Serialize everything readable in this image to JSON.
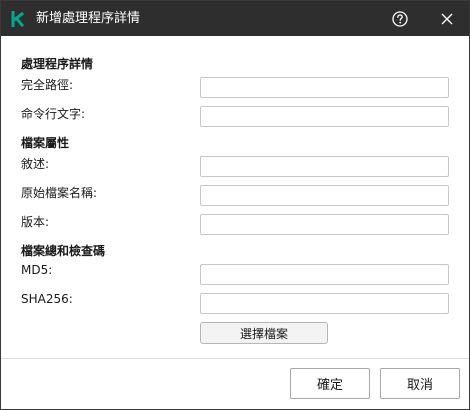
{
  "window": {
    "title": "新增處理程序詳情",
    "logo_icon": "kaspersky-k-logo-icon",
    "logo_color": "#00a88e",
    "help_icon": "help-circle-icon",
    "close_icon": "close-icon"
  },
  "sections": {
    "process_details": {
      "title": "處理程序詳情",
      "full_path_label": "完全路徑:",
      "full_path_value": "",
      "command_line_label": "命令行文字:",
      "command_line_value": ""
    },
    "file_properties": {
      "title": "檔案屬性",
      "description_label": "敘述:",
      "description_value": "",
      "original_name_label": "原始檔案名稱:",
      "original_name_value": "",
      "version_label": "版本:",
      "version_value": ""
    },
    "checksum": {
      "title": "檔案總和檢查碼",
      "md5_label": "MD5:",
      "md5_value": "",
      "sha256_label": "SHA256:",
      "sha256_value": ""
    }
  },
  "buttons": {
    "select_file": "選擇檔案",
    "ok": "確定",
    "cancel": "取消"
  }
}
